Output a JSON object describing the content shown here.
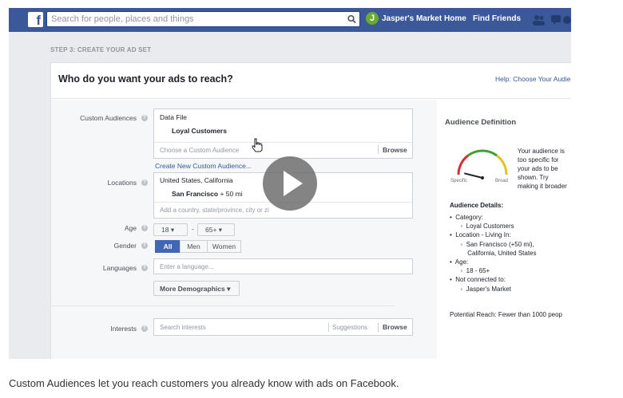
{
  "topbar": {
    "logo": "f",
    "search_placeholder": "Search for people, places and things",
    "page_avatar_letter": "J",
    "page_name": "Jasper's Market",
    "home_label": "Home",
    "find_friends_label": "Find Friends"
  },
  "step_label": "STEP 3: CREATE YOUR AD SET",
  "card": {
    "title": "Who do you want your ads to reach?",
    "help_link": "Help: Choose Your Audie"
  },
  "form": {
    "custom_audiences": {
      "label": "Custom Audiences",
      "group": "Data File",
      "selected": "Loyal Customers",
      "placeholder": "Choose a Custom Audience",
      "browse": "Browse",
      "create_link": "Create New Custom Audience..."
    },
    "locations": {
      "label": "Locations",
      "country": "United States, California",
      "city": "San Francisco",
      "radius": "+ 50 mi",
      "placeholder": "Add a country, state/province, city or zi"
    },
    "age": {
      "label": "Age",
      "min": "18",
      "dash": "-",
      "max": "65+"
    },
    "gender": {
      "label": "Gender",
      "options": [
        "All",
        "Men",
        "Women"
      ],
      "selected": "All"
    },
    "languages": {
      "label": "Languages",
      "placeholder": "Enter a language..."
    },
    "more_demographics": "More Demographics",
    "interests": {
      "label": "Interests",
      "placeholder": "Search interests",
      "suggestions": "Suggestions",
      "browse": "Browse"
    }
  },
  "audience_definition": {
    "title": "Audience Definition",
    "gauge_specific": "Specific",
    "gauge_broad": "Broad",
    "gauge_level": 0.12,
    "message_lines": [
      "Your audience is",
      "too specific for",
      "your ads to be",
      "shown. Try",
      "making it broader"
    ],
    "details_title": "Audience Details:",
    "details_lines": [
      "•  Category:",
      "      ◦  Loyal Customers",
      "•  Location - Living In:",
      "      ◦  San Francisco (+50 mi),",
      "          California, United States",
      "•  Age:",
      "      ◦  18 - 65+",
      "•  Not connected to:",
      "      ◦  Jasper's Market"
    ],
    "potential_reach": "Potential Reach: Fewer than 1000 peop"
  },
  "caption": "Custom Audiences let you reach customers you already know with ads on Facebook.",
  "colors": {
    "brand": "#3b5998",
    "accent": "#4267b2",
    "link": "#365899"
  }
}
